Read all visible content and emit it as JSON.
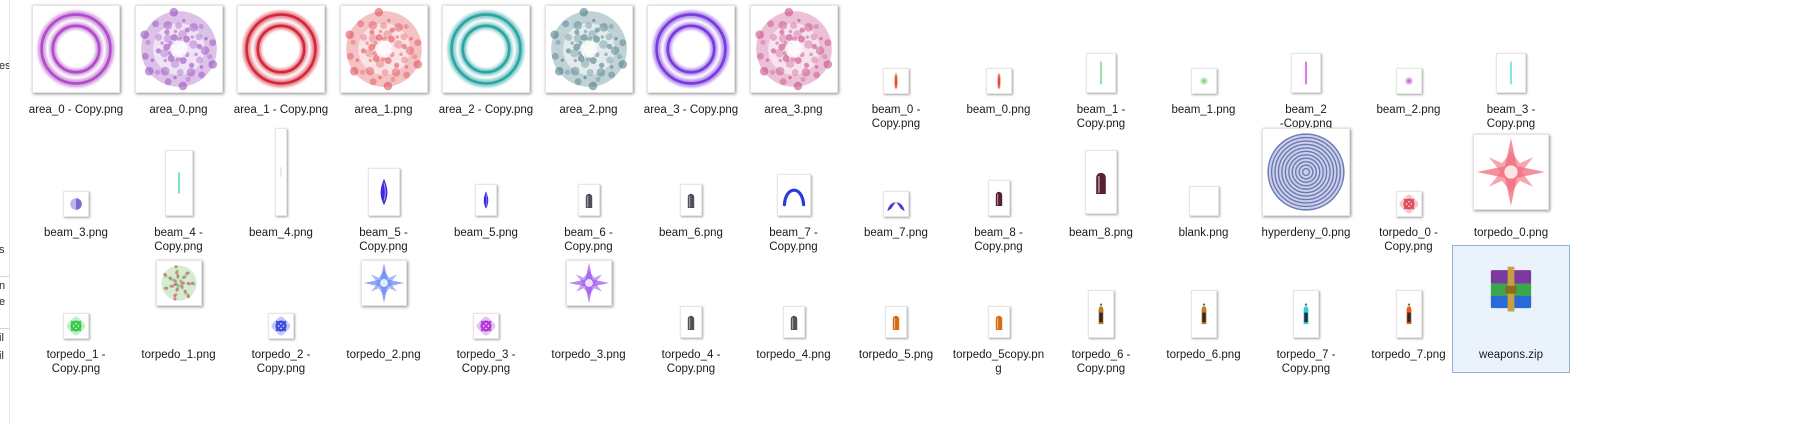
{
  "explorer": {
    "nav_fragments": [
      "es",
      "s",
      "n",
      "e",
      "il",
      "il"
    ]
  },
  "files": [
    {
      "name": "area_0 - Copy.png",
      "label": "area_0 - Copy.png",
      "icon": "area-ring-icon",
      "color": "#b04cc8"
    },
    {
      "name": "area_0.png",
      "label": "area_0.png",
      "icon": "area-swirl-icon",
      "color": "#9a4cc0"
    },
    {
      "name": "area_1 - Copy.png",
      "label": "area_1 - Copy.png",
      "icon": "area-ring-icon",
      "color": "#d4283a"
    },
    {
      "name": "area_1.png",
      "label": "area_1.png",
      "icon": "area-swirl-icon",
      "color": "#e0505a"
    },
    {
      "name": "area_2 - Copy.png",
      "label": "area_2 - Copy.png",
      "icon": "area-ring-icon",
      "color": "#2aa6a2"
    },
    {
      "name": "area_2.png",
      "label": "area_2.png",
      "icon": "area-swirl-icon",
      "color": "#4a7e8a"
    },
    {
      "name": "area_3 - Copy.png",
      "label": "area_3 - Copy.png",
      "icon": "area-ring-icon",
      "color": "#7a3ae0"
    },
    {
      "name": "area_3.png",
      "label": "area_3.png",
      "icon": "area-swirl-icon",
      "color": "#c84a8a"
    },
    {
      "name": "beam_0 - Copy.png",
      "label": "beam_0 -\nCopy.png",
      "icon": "beam-streak-icon",
      "color": "#e8402a"
    },
    {
      "name": "beam_0.png",
      "label": "beam_0.png",
      "icon": "beam-streak-icon",
      "color": "#e8402a"
    },
    {
      "name": "beam_1 - Copy.png",
      "label": "beam_1 -\nCopy.png",
      "icon": "beam-line-icon",
      "color": "#5ad46a"
    },
    {
      "name": "beam_1.png",
      "label": "beam_1.png",
      "icon": "beam-dot-icon",
      "color": "#8ad880"
    },
    {
      "name": "beam_2 -Copy.png",
      "label": "beam_2\n-Copy.png",
      "icon": "beam-line-icon",
      "color": "#c82ad8"
    },
    {
      "name": "beam_2.png",
      "label": "beam_2.png",
      "icon": "beam-dot-icon",
      "color": "#d06ad8"
    },
    {
      "name": "beam_3 - Copy.png",
      "label": "beam_3 -\nCopy.png",
      "icon": "beam-line-icon",
      "color": "#4ad0e0"
    },
    {
      "name": "beam_3.png",
      "label": "beam_3.png",
      "icon": "beam-orb-icon",
      "color": "#7a6ad8"
    },
    {
      "name": "beam_4 - Copy.png",
      "label": "beam_4 -\nCopy.png",
      "icon": "beam-line-icon",
      "color": "#2ad0a0"
    },
    {
      "name": "beam_4.png",
      "label": "beam_4.png",
      "icon": "beam-long-icon",
      "color": "#e0b0a0"
    },
    {
      "name": "beam_5 - Copy.png",
      "label": "beam_5 -\nCopy.png",
      "icon": "beam-drop-icon",
      "color": "#3a2ae0"
    },
    {
      "name": "beam_5.png",
      "label": "beam_5.png",
      "icon": "beam-drop-icon",
      "color": "#3a2ae0"
    },
    {
      "name": "beam_6 - Copy.png",
      "label": "beam_6 -\nCopy.png",
      "icon": "bullet-icon",
      "color": "#505058"
    },
    {
      "name": "beam_6.png",
      "label": "beam_6.png",
      "icon": "bullet-icon",
      "color": "#505058"
    },
    {
      "name": "beam_7 - Copy.png",
      "label": "beam_7 -\nCopy.png",
      "icon": "beam-arc-icon",
      "color": "#2a3ae0"
    },
    {
      "name": "beam_7.png",
      "label": "beam_7.png",
      "icon": "beam-claw-icon",
      "color": "#4a3ae0"
    },
    {
      "name": "beam_8 - Copy.png",
      "label": "beam_8 -\nCopy.png",
      "icon": "bullet-icon",
      "color": "#5a2030"
    },
    {
      "name": "beam_8.png",
      "label": "beam_8.png",
      "icon": "bullet-icon",
      "color": "#5a2030"
    },
    {
      "name": "blank.png",
      "label": "blank.png",
      "icon": "blank-icon",
      "color": "#ffffff"
    },
    {
      "name": "hyperdeny_0.png",
      "label": "hyperdeny_0.png",
      "icon": "hyperdeny-rings-icon",
      "color": "#6a78b8"
    },
    {
      "name": "torpedo_0 - Copy.png",
      "label": "torpedo_0 -\nCopy.png",
      "icon": "torpedo-knot-icon",
      "color": "#e04a5a"
    },
    {
      "name": "torpedo_0.png",
      "label": "torpedo_0.png",
      "icon": "torpedo-star-icon",
      "color": "#f06a7a"
    },
    {
      "name": "torpedo_1 - Copy.png",
      "label": "torpedo_1 -\nCopy.png",
      "icon": "torpedo-knot-icon",
      "color": "#3ac84a"
    },
    {
      "name": "torpedo_1.png",
      "label": "torpedo_1.png",
      "icon": "torpedo-burst-icon",
      "color": "#7ab86a"
    },
    {
      "name": "torpedo_2 - Copy.png",
      "label": "torpedo_2 -\nCopy.png",
      "icon": "torpedo-knot-icon",
      "color": "#3a4ae0"
    },
    {
      "name": "torpedo_2.png",
      "label": "torpedo_2.png",
      "icon": "torpedo-star-icon",
      "color": "#6a8af0"
    },
    {
      "name": "torpedo_3 - Copy.png",
      "label": "torpedo_3 -\nCopy.png",
      "icon": "torpedo-knot-icon",
      "color": "#b03ad8"
    },
    {
      "name": "torpedo_3.png",
      "label": "torpedo_3.png",
      "icon": "torpedo-star-icon",
      "color": "#a05af0"
    },
    {
      "name": "torpedo_4 - Copy.png",
      "label": "torpedo_4 -\nCopy.png",
      "icon": "bullet-icon",
      "color": "#505058"
    },
    {
      "name": "torpedo_4.png",
      "label": "torpedo_4.png",
      "icon": "bullet-icon",
      "color": "#505058"
    },
    {
      "name": "torpedo_5.png",
      "label": "torpedo_5.png",
      "icon": "bullet-icon",
      "color": "#d86a10"
    },
    {
      "name": "torpedo_5copy.png",
      "label": "torpedo_5copy.pn\ng",
      "icon": "bullet-icon",
      "color": "#d86a10"
    },
    {
      "name": "torpedo_6 - Copy.png",
      "label": "torpedo_6 -\nCopy.png",
      "icon": "missile-icon",
      "color": "#c87a20"
    },
    {
      "name": "torpedo_6.png",
      "label": "torpedo_6.png",
      "icon": "missile-icon",
      "color": "#c87a20"
    },
    {
      "name": "torpedo_7 - Copy.png",
      "label": "torpedo_7 -\nCopy.png",
      "icon": "missile-icon",
      "color": "#2ad0e8"
    },
    {
      "name": "torpedo_7.png",
      "label": "torpedo_7.png",
      "icon": "missile-icon",
      "color": "#e8601a"
    },
    {
      "name": "weapons.zip",
      "label": "weapons.zip",
      "icon": "winrar-archive-icon",
      "color": "#7a3aa0",
      "selected": true
    }
  ]
}
